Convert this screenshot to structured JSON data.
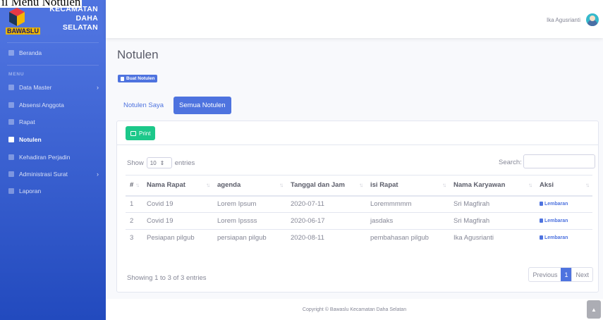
{
  "window": {
    "title": "il Menu Notulen"
  },
  "brand": {
    "line1": "KECAMATAN",
    "line2": "DAHA",
    "line3": "SELATAN",
    "badge": "BAWASLU"
  },
  "sidebar": {
    "heading": "MENU",
    "items": [
      {
        "label": "Beranda",
        "icon": "tachometer-icon"
      },
      {
        "label": "Data Master",
        "icon": "folder-icon",
        "chevron": "›"
      },
      {
        "label": "Absensi Anggota",
        "icon": "id-card-icon"
      },
      {
        "label": "Rapat",
        "icon": "users-icon"
      },
      {
        "label": "Notulen",
        "icon": "file-icon"
      },
      {
        "label": "Kehadiran Perjadin",
        "icon": "car-icon"
      },
      {
        "label": "Administrasi Surat",
        "icon": "envelope-icon",
        "chevron": "›"
      },
      {
        "label": "Laporan",
        "icon": "file-alt-icon"
      }
    ]
  },
  "topbar": {
    "user_name": "Ika Agusrianti"
  },
  "page": {
    "title": "Notulen",
    "buat_label": "Buat Notulen",
    "tabs": [
      "Notulen Saya",
      "Semua Notulen"
    ]
  },
  "card": {
    "print_label": "Print",
    "show_label": "Show",
    "entries_value": "10",
    "entries_label": "entries",
    "search_label": "Search:",
    "columns": [
      "#",
      "Nama Rapat",
      "agenda",
      "Tanggal dan Jam",
      "isi Rapat",
      "Nama Karyawan",
      "Aksi"
    ],
    "rows": [
      [
        "1",
        "Covid 19",
        "Lorem Ipsum",
        "2020-07-11",
        "Loremmmmm",
        "Sri Magfirah",
        "Lembaran"
      ],
      [
        "2",
        "Covid 19",
        "Lorem Ipssss",
        "2020-06-17",
        "jasdaks",
        "Sri Magfirah",
        "Lembaran"
      ],
      [
        "3",
        "Pesiapan pilgub",
        "persiapan pilgub",
        "2020-08-11",
        "pembahasan pilgub",
        "Ika Agusrianti",
        "Lembaran"
      ]
    ],
    "info": "Showing 1 to 3 of 3 entries",
    "pager": {
      "prev": "Previous",
      "current": "1",
      "next": "Next"
    }
  },
  "footer": {
    "text": "Copyright © Bawaslu Kecamatan Daha Selatan"
  },
  "colors": {
    "primary": "#4e73df",
    "success": "#1cc88a"
  }
}
